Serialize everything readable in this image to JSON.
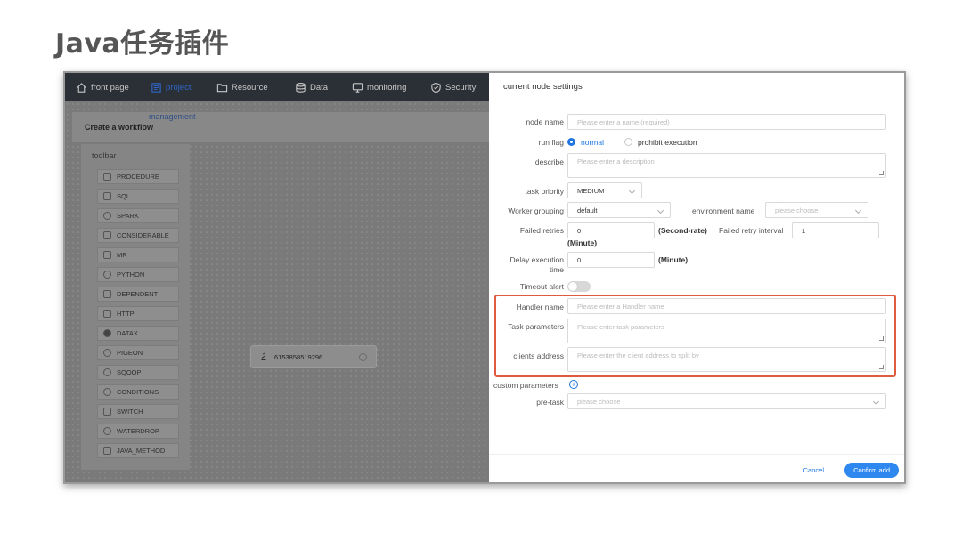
{
  "slide": {
    "title": "Java任务插件"
  },
  "nav": [
    {
      "label": "front page",
      "icon": "home-icon"
    },
    {
      "label": "project",
      "icon": "project-icon"
    },
    {
      "label": "Resource",
      "icon": "folder-icon"
    },
    {
      "label": "Data",
      "icon": "database-icon"
    },
    {
      "label": "monitoring",
      "icon": "monitor-icon"
    },
    {
      "label": "Security",
      "icon": "shield-icon"
    }
  ],
  "workflow": {
    "management": "management",
    "create": "Create a workflow"
  },
  "toolbar": {
    "title": "toolbar",
    "items": [
      "PROCEDURE",
      "SQL",
      "SPARK",
      "CONSIDERABLE",
      "MR",
      "PYTHON",
      "DEPENDENT",
      "HTTP",
      "DATAX",
      "PIGEON",
      "SQOOP",
      "CONDITIONS",
      "SWITCH",
      "WATERDROP",
      "JAVA_METHOD"
    ]
  },
  "node": {
    "id": "6153858519296"
  },
  "panel": {
    "title": "current node settings",
    "node_name": {
      "label": "node name",
      "placeholder": "Please enter a name (required)"
    },
    "run_flag": {
      "label": "run flag",
      "opt_normal": "normal",
      "opt_prohibit": "prohibit execution"
    },
    "describe": {
      "label": "describe",
      "placeholder": "Please enter a description"
    },
    "task_priority": {
      "label": "task priority",
      "value": "MEDIUM"
    },
    "worker_grouping": {
      "label": "Worker grouping",
      "value": "default"
    },
    "environment": {
      "label": "environment name",
      "placeholder": "please choose"
    },
    "failed_retries": {
      "label": "Failed retries",
      "value": "0",
      "unit": "(Second-rate)"
    },
    "retry_interval": {
      "label": "Failed retry interval",
      "value": "1",
      "unit": "(Minute)"
    },
    "delay": {
      "label_1": "Delay execution",
      "label_2": "time",
      "value": "0",
      "unit": "(Minute)"
    },
    "timeout": {
      "label": "Timeout alert"
    },
    "handler": {
      "label": "Handler name",
      "placeholder": "Please enter a Handler name"
    },
    "task_params": {
      "label": "Task parameters",
      "placeholder": "Please enter task parameters"
    },
    "clients": {
      "label": "clients address",
      "placeholder": "Please enter the client address to split by"
    },
    "custom_params": {
      "label": "custom parameters"
    },
    "pre_task": {
      "label": "pre-task",
      "placeholder": "please choose"
    },
    "cancel": "Cancel",
    "confirm": "Confirm add"
  },
  "colors": {
    "accent": "#1f76e0",
    "highlight": "#e05a3f",
    "nav_bg": "#2b2f36"
  }
}
